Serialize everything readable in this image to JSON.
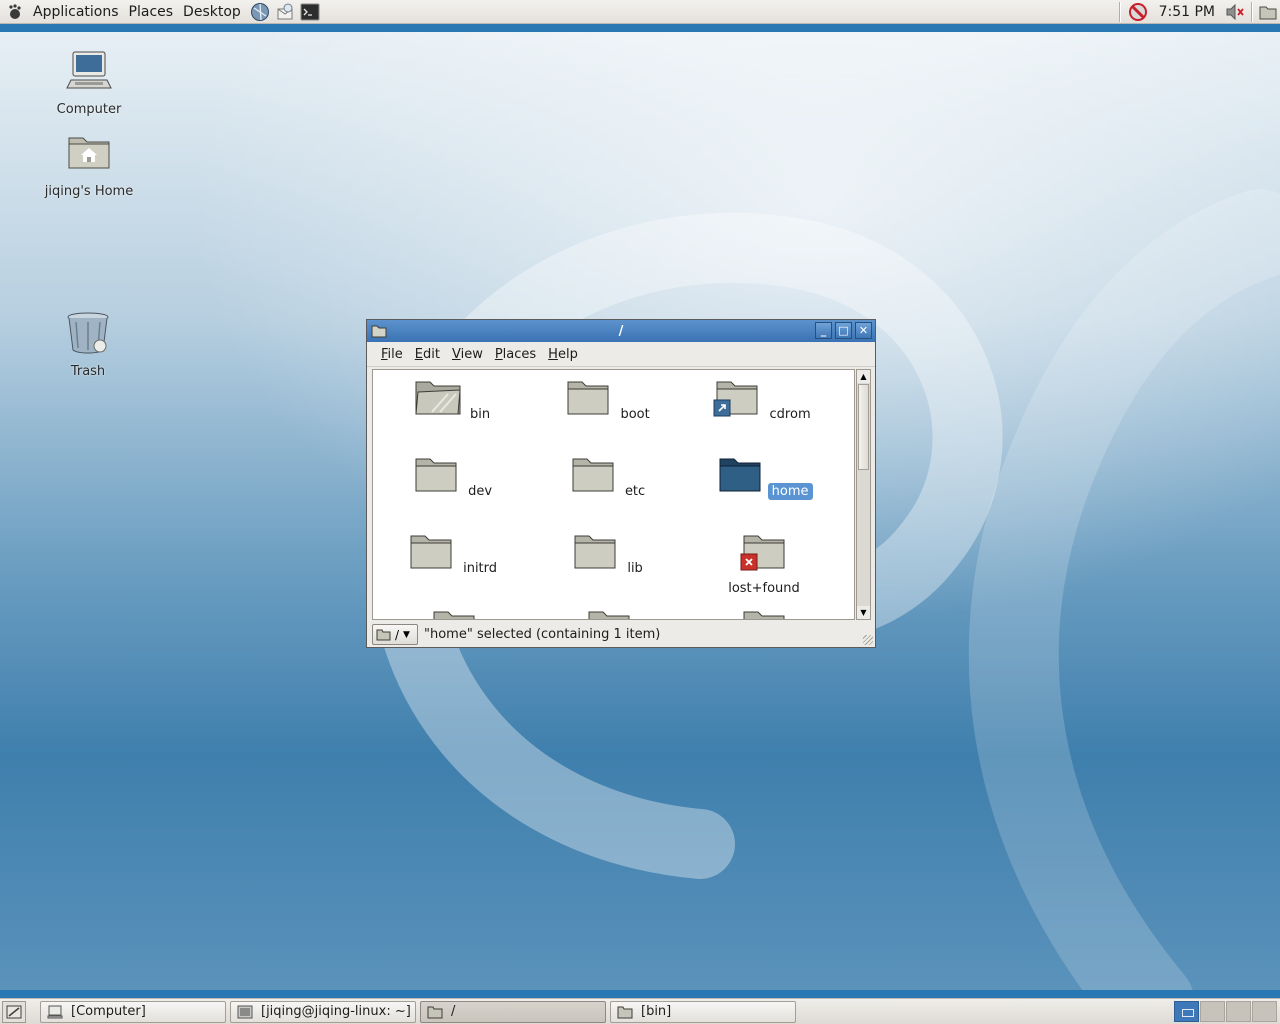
{
  "top_panel": {
    "menus": [
      "Applications",
      "Places",
      "Desktop"
    ],
    "clock": "7:51 PM"
  },
  "desktop": {
    "icons": [
      {
        "label": "Computer",
        "icon": "computer-icon"
      },
      {
        "label": "jiqing's Home",
        "icon": "home-folder-icon"
      },
      {
        "label": "Trash",
        "icon": "trash-icon"
      }
    ]
  },
  "file_manager": {
    "title": "/",
    "menus": [
      {
        "accel": "F",
        "rest": "ile"
      },
      {
        "accel": "E",
        "rest": "dit"
      },
      {
        "accel": "V",
        "rest": "iew"
      },
      {
        "accel": "P",
        "rest": "laces"
      },
      {
        "accel": "H",
        "rest": "elp"
      }
    ],
    "items": [
      {
        "name": "bin"
      },
      {
        "name": "boot"
      },
      {
        "name": "cdrom"
      },
      {
        "name": "dev"
      },
      {
        "name": "etc"
      },
      {
        "name": "home"
      },
      {
        "name": "initrd"
      },
      {
        "name": "lib"
      },
      {
        "name": "lost+found"
      }
    ],
    "selected": "home",
    "path_button": "/",
    "status": "\"home\" selected (containing 1 item)"
  },
  "taskbar": {
    "tasks": [
      {
        "label": "[Computer]"
      },
      {
        "label": "[jiqing@jiqing-linux: ~]"
      },
      {
        "label": "/"
      },
      {
        "label": "[bin]"
      }
    ],
    "active_task": "/"
  },
  "colors": {
    "title_bar": "#3a72b3",
    "selection": "#5a94d2",
    "panel": "#e4e1dc"
  }
}
